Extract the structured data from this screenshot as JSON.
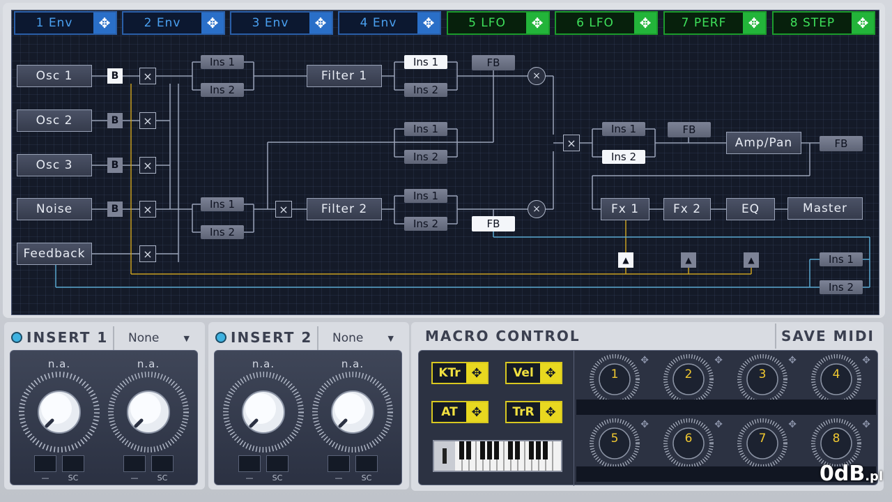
{
  "tabs": [
    {
      "label": "1 Env",
      "kind": "env"
    },
    {
      "label": "2 Env",
      "kind": "env"
    },
    {
      "label": "3 Env",
      "kind": "env"
    },
    {
      "label": "4 Env",
      "kind": "env"
    },
    {
      "label": "5 LFO",
      "kind": "lfo"
    },
    {
      "label": "6 LFO",
      "kind": "lfo"
    },
    {
      "label": "7 PERF",
      "kind": "lfo"
    },
    {
      "label": "8 STEP",
      "kind": "lfo"
    }
  ],
  "sources": {
    "osc1": "Osc 1",
    "osc2": "Osc 2",
    "osc3": "Osc 3",
    "noise": "Noise",
    "feedback": "Feedback"
  },
  "routing": {
    "b_label": "B",
    "x_symbol": "×",
    "mult_symbol": "×",
    "ins1": "Ins 1",
    "ins2": "Ins 2",
    "fb": "FB",
    "filter1": "Filter 1",
    "filter2": "Filter 2",
    "amp_pan": "Amp/Pan",
    "fx1": "Fx 1",
    "fx2": "Fx 2",
    "eq": "EQ",
    "master": "Master",
    "tri_symbol": "▲"
  },
  "insert1": {
    "title": "INSERT 1",
    "select": "None",
    "knob1": "n.a.",
    "knob2": "n.a.",
    "btn_minus": "—",
    "btn_sc": "SC"
  },
  "insert2": {
    "title": "INSERT 2",
    "select": "None",
    "knob1": "n.a.",
    "knob2": "n.a.",
    "btn_minus": "—",
    "btn_sc": "SC"
  },
  "macro": {
    "title": "MACRO CONTROL",
    "save_midi": "SAVE MIDI",
    "sources": [
      "KTr",
      "Vel",
      "AT",
      "TrR"
    ],
    "knobs": [
      "1",
      "2",
      "3",
      "4",
      "5",
      "6",
      "7",
      "8"
    ]
  },
  "watermark": {
    "main": "0dB",
    "suffix": ".pl"
  },
  "colors": {
    "env_tab": "#2a6fc8",
    "lfo_tab": "#23b43a",
    "mod_wire": "#c8a020",
    "fb_wire": "#5aa8d0",
    "macro_accent": "#e8d820"
  },
  "icons": {
    "move": "move-arrows-icon",
    "dropdown": "triangle-down-icon"
  }
}
